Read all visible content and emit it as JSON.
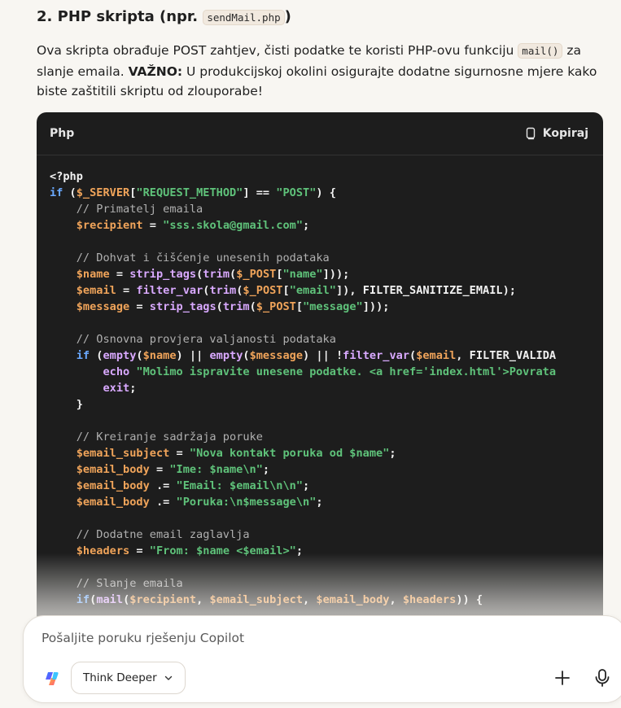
{
  "section": {
    "heading_prefix": "2. PHP skripta (npr. ",
    "heading_code": "sendMail.php",
    "heading_suffix": ")",
    "desc_part1": "Ova skripta obrađuje POST zahtjev, čisti podatke te koristi PHP-ovu funkciju ",
    "desc_code": "mail()",
    "desc_part2": " za slanje emaila. ",
    "desc_bold": "VAŽNO:",
    "desc_part3": " U produkcijskoj okolini osigurajte dodatne sigurnosne mjere kako biste zaštitili skriptu od zlouporabe!"
  },
  "codeblock": {
    "language": "Php",
    "copy_label": "Kopiraj",
    "lines": [
      [
        [
          "plain",
          "<?php"
        ]
      ],
      [
        [
          "kw",
          "if"
        ],
        [
          "pun",
          " ("
        ],
        [
          "var",
          "$_SERVER"
        ],
        [
          "pun",
          "["
        ],
        [
          "str",
          "\"REQUEST_METHOD\""
        ],
        [
          "pun",
          "] == "
        ],
        [
          "str",
          "\"POST\""
        ],
        [
          "pun",
          ") {"
        ]
      ],
      [
        [
          "com",
          "    // Primatelj emaila"
        ]
      ],
      [
        [
          "pun",
          "    "
        ],
        [
          "var",
          "$recipient"
        ],
        [
          "pun",
          " = "
        ],
        [
          "str",
          "\"sss.skola@gmail.com\""
        ],
        [
          "pun",
          ";"
        ]
      ],
      [
        [
          "pun",
          ""
        ]
      ],
      [
        [
          "com",
          "    // Dohvat i čišćenje unesenih podataka"
        ]
      ],
      [
        [
          "pun",
          "    "
        ],
        [
          "var",
          "$name"
        ],
        [
          "pun",
          " = "
        ],
        [
          "fn",
          "strip_tags"
        ],
        [
          "pun",
          "("
        ],
        [
          "fn",
          "trim"
        ],
        [
          "pun",
          "("
        ],
        [
          "var",
          "$_POST"
        ],
        [
          "pun",
          "["
        ],
        [
          "str",
          "\"name\""
        ],
        [
          "pun",
          "]));"
        ]
      ],
      [
        [
          "pun",
          "    "
        ],
        [
          "var",
          "$email"
        ],
        [
          "pun",
          " = "
        ],
        [
          "fn",
          "filter_var"
        ],
        [
          "pun",
          "("
        ],
        [
          "fn",
          "trim"
        ],
        [
          "pun",
          "("
        ],
        [
          "var",
          "$_POST"
        ],
        [
          "pun",
          "["
        ],
        [
          "str",
          "\"email\""
        ],
        [
          "pun",
          "]), FILTER_SANITIZE_EMAIL);"
        ]
      ],
      [
        [
          "pun",
          "    "
        ],
        [
          "var",
          "$message"
        ],
        [
          "pun",
          " = "
        ],
        [
          "fn",
          "strip_tags"
        ],
        [
          "pun",
          "("
        ],
        [
          "fn",
          "trim"
        ],
        [
          "pun",
          "("
        ],
        [
          "var",
          "$_POST"
        ],
        [
          "pun",
          "["
        ],
        [
          "str",
          "\"message\""
        ],
        [
          "pun",
          "]));"
        ]
      ],
      [
        [
          "pun",
          ""
        ]
      ],
      [
        [
          "com",
          "    // Osnovna provjera valjanosti podataka"
        ]
      ],
      [
        [
          "pun",
          "    "
        ],
        [
          "kw",
          "if"
        ],
        [
          "pun",
          " ("
        ],
        [
          "fn",
          "empty"
        ],
        [
          "pun",
          "("
        ],
        [
          "var",
          "$name"
        ],
        [
          "pun",
          ") || "
        ],
        [
          "fn",
          "empty"
        ],
        [
          "pun",
          "("
        ],
        [
          "var",
          "$message"
        ],
        [
          "pun",
          ") || !"
        ],
        [
          "fn",
          "filter_var"
        ],
        [
          "pun",
          "("
        ],
        [
          "var",
          "$email"
        ],
        [
          "pun",
          ", FILTER_VALIDA"
        ]
      ],
      [
        [
          "pun",
          "        "
        ],
        [
          "fn",
          "echo"
        ],
        [
          "pun",
          " "
        ],
        [
          "str",
          "\"Molimo ispravite unesene podatke. <a href='index.html'>Povrata"
        ]
      ],
      [
        [
          "pun",
          "        "
        ],
        [
          "fn",
          "exit"
        ],
        [
          "pun",
          ";"
        ]
      ],
      [
        [
          "pun",
          "    }"
        ]
      ],
      [
        [
          "pun",
          ""
        ]
      ],
      [
        [
          "com",
          "    // Kreiranje sadržaja poruke"
        ]
      ],
      [
        [
          "pun",
          "    "
        ],
        [
          "var",
          "$email_subject"
        ],
        [
          "pun",
          " = "
        ],
        [
          "str",
          "\"Nova kontakt poruka od $name\""
        ],
        [
          "pun",
          ";"
        ]
      ],
      [
        [
          "pun",
          "    "
        ],
        [
          "var",
          "$email_body"
        ],
        [
          "pun",
          " = "
        ],
        [
          "str",
          "\"Ime: $name\\n\""
        ],
        [
          "pun",
          ";"
        ]
      ],
      [
        [
          "pun",
          "    "
        ],
        [
          "var",
          "$email_body"
        ],
        [
          "pun",
          " .= "
        ],
        [
          "str",
          "\"Email: $email\\n\\n\""
        ],
        [
          "pun",
          ";"
        ]
      ],
      [
        [
          "pun",
          "    "
        ],
        [
          "var",
          "$email_body"
        ],
        [
          "pun",
          " .= "
        ],
        [
          "str",
          "\"Poruka:\\n$message\\n\""
        ],
        [
          "pun",
          ";"
        ]
      ],
      [
        [
          "pun",
          ""
        ]
      ],
      [
        [
          "com",
          "    // Dodatne email zaglavlja"
        ]
      ],
      [
        [
          "pun",
          "    "
        ],
        [
          "var",
          "$headers"
        ],
        [
          "pun",
          " = "
        ],
        [
          "str",
          "\"From: $name <$email>\""
        ],
        [
          "pun",
          ";"
        ]
      ],
      [
        [
          "pun",
          ""
        ]
      ],
      [
        [
          "com",
          "    // Slanje emaila"
        ]
      ],
      [
        [
          "pun",
          "    "
        ],
        [
          "kw",
          "if"
        ],
        [
          "pun",
          "("
        ],
        [
          "fn",
          "mail"
        ],
        [
          "pun",
          "("
        ],
        [
          "var",
          "$recipient"
        ],
        [
          "pun",
          ", "
        ],
        [
          "var",
          "$email_subject"
        ],
        [
          "pun",
          ", "
        ],
        [
          "var",
          "$email_body"
        ],
        [
          "pun",
          ", "
        ],
        [
          "var",
          "$headers"
        ],
        [
          "pun",
          ")) {"
        ]
      ]
    ]
  },
  "composer": {
    "placeholder": "Pošaljite poruku rješenju Copilot",
    "think_label": "Think Deeper"
  },
  "icons": {
    "copy": "copy-icon",
    "logo": "copilot-logo-icon",
    "chevron": "chevron-down-icon",
    "plus": "plus-icon",
    "mic": "microphone-icon"
  }
}
